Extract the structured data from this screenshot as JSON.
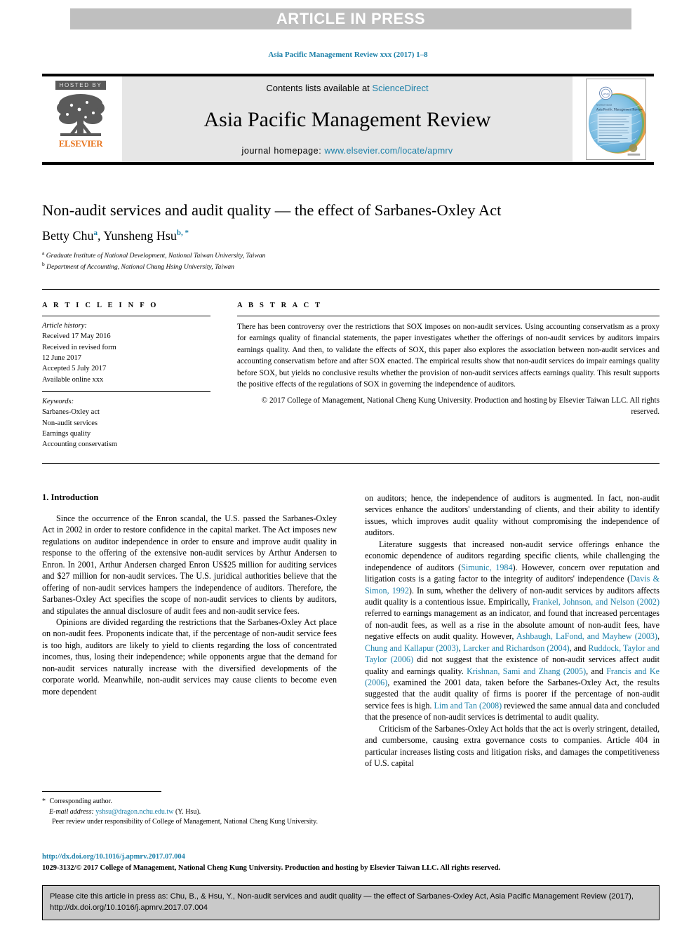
{
  "banner": {
    "label": "ARTICLE IN PRESS"
  },
  "journal_ref": "Asia Pacific Management Review xxx (2017) 1–8",
  "masthead": {
    "hosted_by": "HOSTED BY",
    "publisher": "ELSEVIER",
    "contents_prefix": "Contents lists available at ",
    "contents_link": "ScienceDirect",
    "journal_title": "Asia Pacific Management Review",
    "homepage_prefix": "journal homepage: ",
    "homepage_link": "www.elsevier.com/locate/apmrv",
    "cover_title_small": "A Global Journal",
    "cover_title": "Asia Pacific Management Review"
  },
  "article": {
    "title": "Non-audit services and audit quality — the effect of Sarbanes-Oxley Act",
    "authors_prefix": "Betty Chu",
    "author_a_marker": "a",
    "authors_middle": ", Yunsheng Hsu",
    "author_b_marker": "b, *",
    "affiliation_a_marker": "a",
    "affiliation_a": " Graduate Institute of National Development, National Taiwan University, Taiwan",
    "affiliation_b_marker": "b",
    "affiliation_b": " Department of Accounting, National Chung Hsing University, Taiwan"
  },
  "info": {
    "heading": "A R T I C L E   I N F O",
    "history_label": "Article history:",
    "history": [
      "Received 17 May 2016",
      "Received in revised form",
      "12 June 2017",
      "Accepted 5 July 2017",
      "Available online xxx"
    ],
    "keywords_label": "Keywords:",
    "keywords": [
      "Sarbanes-Oxley act",
      "Non-audit services",
      "Earnings quality",
      "Accounting conservatism"
    ]
  },
  "abstract": {
    "heading": "A B S T R A C T",
    "text": "There has been controversy over the restrictions that SOX imposes on non-audit services. Using accounting conservatism as a proxy for earnings quality of financial statements, the paper investigates whether the offerings of non-audit services by auditors impairs earnings quality. And then, to validate the effects of SOX, this paper also explores the association between non-audit services and accounting conservatism before and after SOX enacted. The empirical results show that non-audit services do impair earnings quality before SOX, but yields no conclusive results whether the provision of non-audit services affects earnings quality. This result supports the positive effects of the regulations of SOX in governing the independence of auditors.",
    "copyright": "© 2017 College of Management, National Cheng Kung University. Production and hosting by Elsevier Taiwan LLC. All rights reserved."
  },
  "body": {
    "section_title": "1. Introduction",
    "left_paragraphs": [
      "Since the occurrence of the Enron scandal, the U.S. passed the Sarbanes-Oxley Act in 2002 in order to restore confidence in the capital market. The Act imposes new regulations on auditor independence in order to ensure and improve audit quality in response to the offering of the extensive non-audit services by Arthur Andersen to Enron. In 2001, Arthur Andersen charged Enron US$25 million for auditing services and $27 million for non-audit services. The U.S. juridical authorities believe that the offering of non-audit services hampers the independence of auditors. Therefore, the Sarbanes-Oxley Act specifies the scope of non-audit services to clients by auditors, and stipulates the annual disclosure of audit fees and non-audit service fees.",
      "Opinions are divided regarding the restrictions that the Sarbanes-Oxley Act place on non-audit fees. Proponents indicate that, if the percentage of non-audit service fees is too high, auditors are likely to yield to clients regarding the loss of concentrated incomes, thus, losing their independence; while opponents argue that the demand for non-audit services naturally increase with the diversified developments of the corporate world. Meanwhile, non-audit services may cause clients to become even more dependent"
    ],
    "right_paragraph_1": "on auditors; hence, the independence of auditors is augmented. In fact, non-audit services enhance the auditors' understanding of clients, and their ability to identify issues, which improves audit quality without compromising the independence of auditors.",
    "right_paragraph_2_parts": [
      {
        "text": "Literature suggests that increased non-audit service offerings enhance the economic dependence of auditors regarding specific clients, while challenging the independence of auditors (",
        "link": false
      },
      {
        "text": "Simunic, 1984",
        "link": true
      },
      {
        "text": "). However, concern over reputation and litigation costs is a gating factor to the integrity of auditors' independence (",
        "link": false
      },
      {
        "text": "Davis & Simon, 1992",
        "link": true
      },
      {
        "text": "). In sum, whether the delivery of non-audit services by auditors affects audit quality is a contentious issue. Empirically, ",
        "link": false
      },
      {
        "text": "Frankel, Johnson, and Nelson (2002)",
        "link": true
      },
      {
        "text": " referred to earnings management as an indicator, and found that increased percentages of non-audit fees, as well as a rise in the absolute amount of non-audit fees, have negative effects on audit quality. However, ",
        "link": false
      },
      {
        "text": "Ashbaugh, LaFond, and Mayhew (2003)",
        "link": true
      },
      {
        "text": ", ",
        "link": false
      },
      {
        "text": "Chung and Kallapur (2003)",
        "link": true
      },
      {
        "text": ", ",
        "link": false
      },
      {
        "text": "Larcker and Richardson (2004)",
        "link": true
      },
      {
        "text": ", and ",
        "link": false
      },
      {
        "text": "Ruddock, Taylor and Taylor (2006)",
        "link": true
      },
      {
        "text": " did not suggest that the existence of non-audit services affect audit quality and earnings quality. ",
        "link": false
      },
      {
        "text": "Krishnan, Sami and Zhang (2005)",
        "link": true
      },
      {
        "text": ", and ",
        "link": false
      },
      {
        "text": "Francis and Ke (2006)",
        "link": true
      },
      {
        "text": ", examined the 2001 data, taken before the Sarbanes-Oxley Act, the results suggested that the audit quality of firms is poorer if the percentage of non-audit service fees is high. ",
        "link": false
      },
      {
        "text": "Lim and Tan (2008)",
        "link": true
      },
      {
        "text": " reviewed the same annual data and concluded that the presence of non-audit services is detrimental to audit quality.",
        "link": false
      }
    ],
    "right_paragraph_3": "Criticism of the Sarbanes-Oxley Act holds that the act is overly stringent, detailed, and cumbersome, causing extra governance costs to companies. Article 404 in particular increases listing costs and litigation risks, and damages the competitiveness of U.S. capital"
  },
  "footnotes": {
    "corresponding_marker": "*",
    "corresponding": " Corresponding author.",
    "email_label": "E-mail address:",
    "email": "yshsu@dragon.nchu.edu.tw",
    "email_suffix": " (Y. Hsu).",
    "peer_review": "Peer review under responsibility of College of Management, National Cheng Kung University."
  },
  "doi": "http://dx.doi.org/10.1016/j.apmrv.2017.07.004",
  "copyright_line": "1029-3132/© 2017 College of Management, National Cheng Kung University. Production and hosting by Elsevier Taiwan LLC. All rights reserved.",
  "citation_box": {
    "text": "Please cite this article in press as: Chu, B., & Hsu, Y., Non-audit services and audit quality — the effect of Sarbanes-Oxley Act, Asia Pacific Management Review (2017), http://dx.doi.org/10.1016/j.apmrv.2017.07.004"
  },
  "colors": {
    "link": "#1a7fa8",
    "banner_bg": "#bfbfbf",
    "masthead_bg": "#e6e6e6",
    "elsevier_orange": "#e87722",
    "cite_box_bg": "#c9c9c9"
  }
}
